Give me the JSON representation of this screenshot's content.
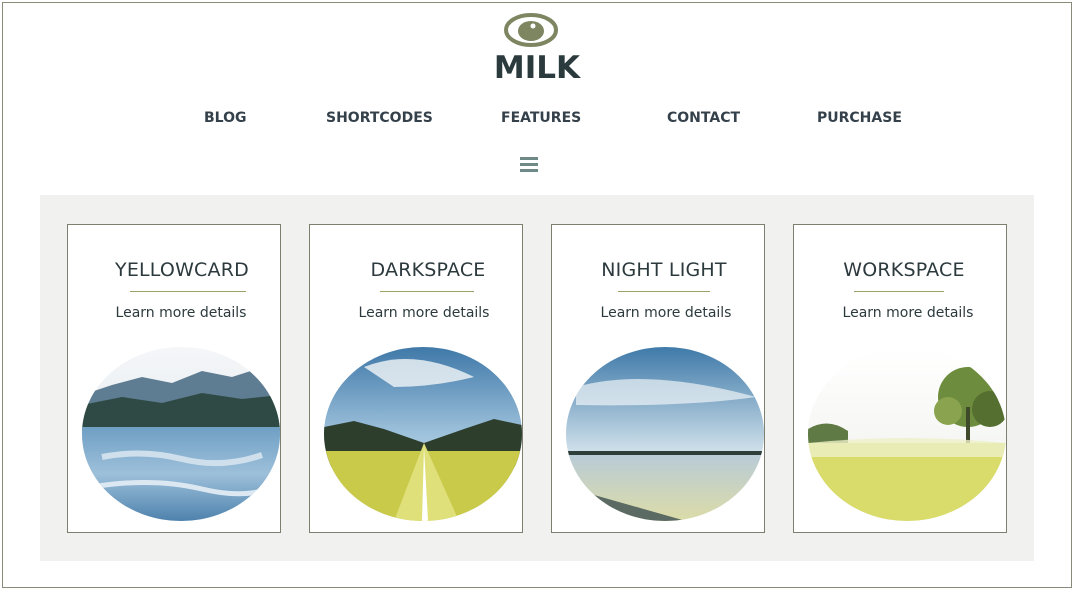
{
  "brand": {
    "name": "MILK",
    "logo_icon": "eye-bean-logo-icon",
    "accent": "#7d8661"
  },
  "nav": {
    "items": [
      "BLOG",
      "SHORTCODES",
      "FEATURES",
      "CONTACT",
      "PURCHASE"
    ],
    "menu_icon": "hamburger-menu-icon"
  },
  "cards": [
    {
      "title": "YELLOWCARD",
      "link": "Learn more details",
      "image": "mountain-lake-photo"
    },
    {
      "title": "DARKSPACE",
      "link": "Learn more details",
      "image": "country-road-photo"
    },
    {
      "title": "NIGHT LIGHT",
      "link": "Learn more details",
      "image": "lake-sky-photo"
    },
    {
      "title": "WORKSPACE",
      "link": "Learn more details",
      "image": "meadow-tree-photo"
    }
  ],
  "colors": {
    "panel": "#f1f1ef",
    "text": "#2c3a3e",
    "rule": "#9aa468"
  }
}
